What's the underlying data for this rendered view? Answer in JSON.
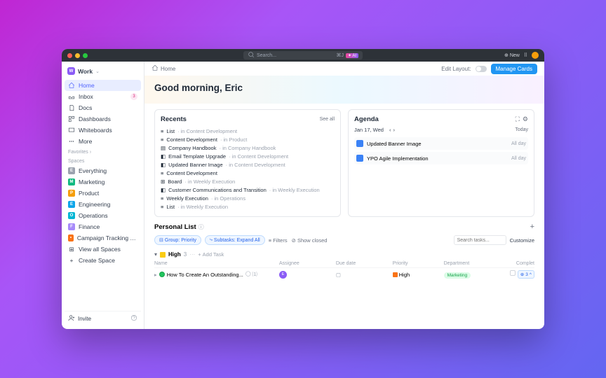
{
  "titlebar": {
    "search_label": "Search...",
    "search_kbd": "⌘J",
    "ai_label": "✦ AI",
    "new_label": "New"
  },
  "workspace": {
    "name": "Work",
    "initial": "W"
  },
  "nav": {
    "items": [
      {
        "label": "Home"
      },
      {
        "label": "Inbox",
        "badge": "3"
      },
      {
        "label": "Docs"
      },
      {
        "label": "Dashboards"
      },
      {
        "label": "Whiteboards"
      },
      {
        "label": "More"
      }
    ]
  },
  "favorites_label": "Favorites",
  "spaces_label": "Spaces",
  "spaces": {
    "items": [
      {
        "label": "Everything",
        "color": "#9ca3af",
        "initial": "E"
      },
      {
        "label": "Marketing",
        "color": "#10b981",
        "initial": "M"
      },
      {
        "label": "Product",
        "color": "#f59e0b",
        "initial": "P"
      },
      {
        "label": "Engineering",
        "color": "#0ea5e9",
        "initial": "E"
      },
      {
        "label": "Operations",
        "color": "#06b6d4",
        "initial": "O"
      },
      {
        "label": "Finance",
        "color": "#a78bfa",
        "initial": "F"
      },
      {
        "label": "Campaign Tracking Template",
        "color": "#f97316",
        "initial": "•"
      }
    ],
    "view_all": "View all Spaces",
    "create": "Create Space"
  },
  "invite_label": "Invite",
  "topbar": {
    "breadcrumb": "Home",
    "edit_layout": "Edit Layout:",
    "manage": "Manage Cards"
  },
  "greeting": "Good morning, Eric",
  "recents": {
    "title": "Recents",
    "see_all": "See all",
    "items": [
      {
        "name": "List",
        "ctx": "· in Content Development"
      },
      {
        "name": "Content Development",
        "ctx": "· in Product"
      },
      {
        "name": "Company Handbook",
        "ctx": "· in Company Handbook"
      },
      {
        "name": "Email Template Upgrade",
        "ctx": "· in Content Development"
      },
      {
        "name": "Updated Banner Image",
        "ctx": "· in Content Development"
      },
      {
        "name": "Content Development",
        "ctx": ""
      },
      {
        "name": "Board",
        "ctx": "· in Weekly Execution"
      },
      {
        "name": "Customer Communications and Transition",
        "ctx": "· in Weekly Execution"
      },
      {
        "name": "Weekly Execution",
        "ctx": "· in Operations"
      },
      {
        "name": "List",
        "ctx": "· in Weekly Execution"
      }
    ]
  },
  "agenda": {
    "title": "Agenda",
    "date": "Jan 17, Wed",
    "today_label": "Today",
    "items": [
      {
        "name": "Updated Banner Image",
        "tag": "All day"
      },
      {
        "name": "YPO Agile Implementation",
        "tag": "All day"
      }
    ]
  },
  "personal": {
    "title": "Personal List",
    "group_chip": "Group: Priority",
    "subtasks_chip": "Subtasks: Expand All",
    "filters_label": "Filters",
    "show_closed_label": "Show closed",
    "search_placeholder": "Search tasks...",
    "customize_label": "Customize",
    "group_name": "High",
    "group_count": "3",
    "add_task_label": "Add Task",
    "cols": {
      "name": "Name",
      "assignee": "Assignee",
      "due": "Due date",
      "priority": "Priority",
      "dept": "Department",
      "complete": "Complet"
    },
    "task": {
      "name": "How To Create An Outstanding...",
      "assignee_initial": "E",
      "priority": "High",
      "dept": "Marketing"
    },
    "fab_count": "3"
  }
}
